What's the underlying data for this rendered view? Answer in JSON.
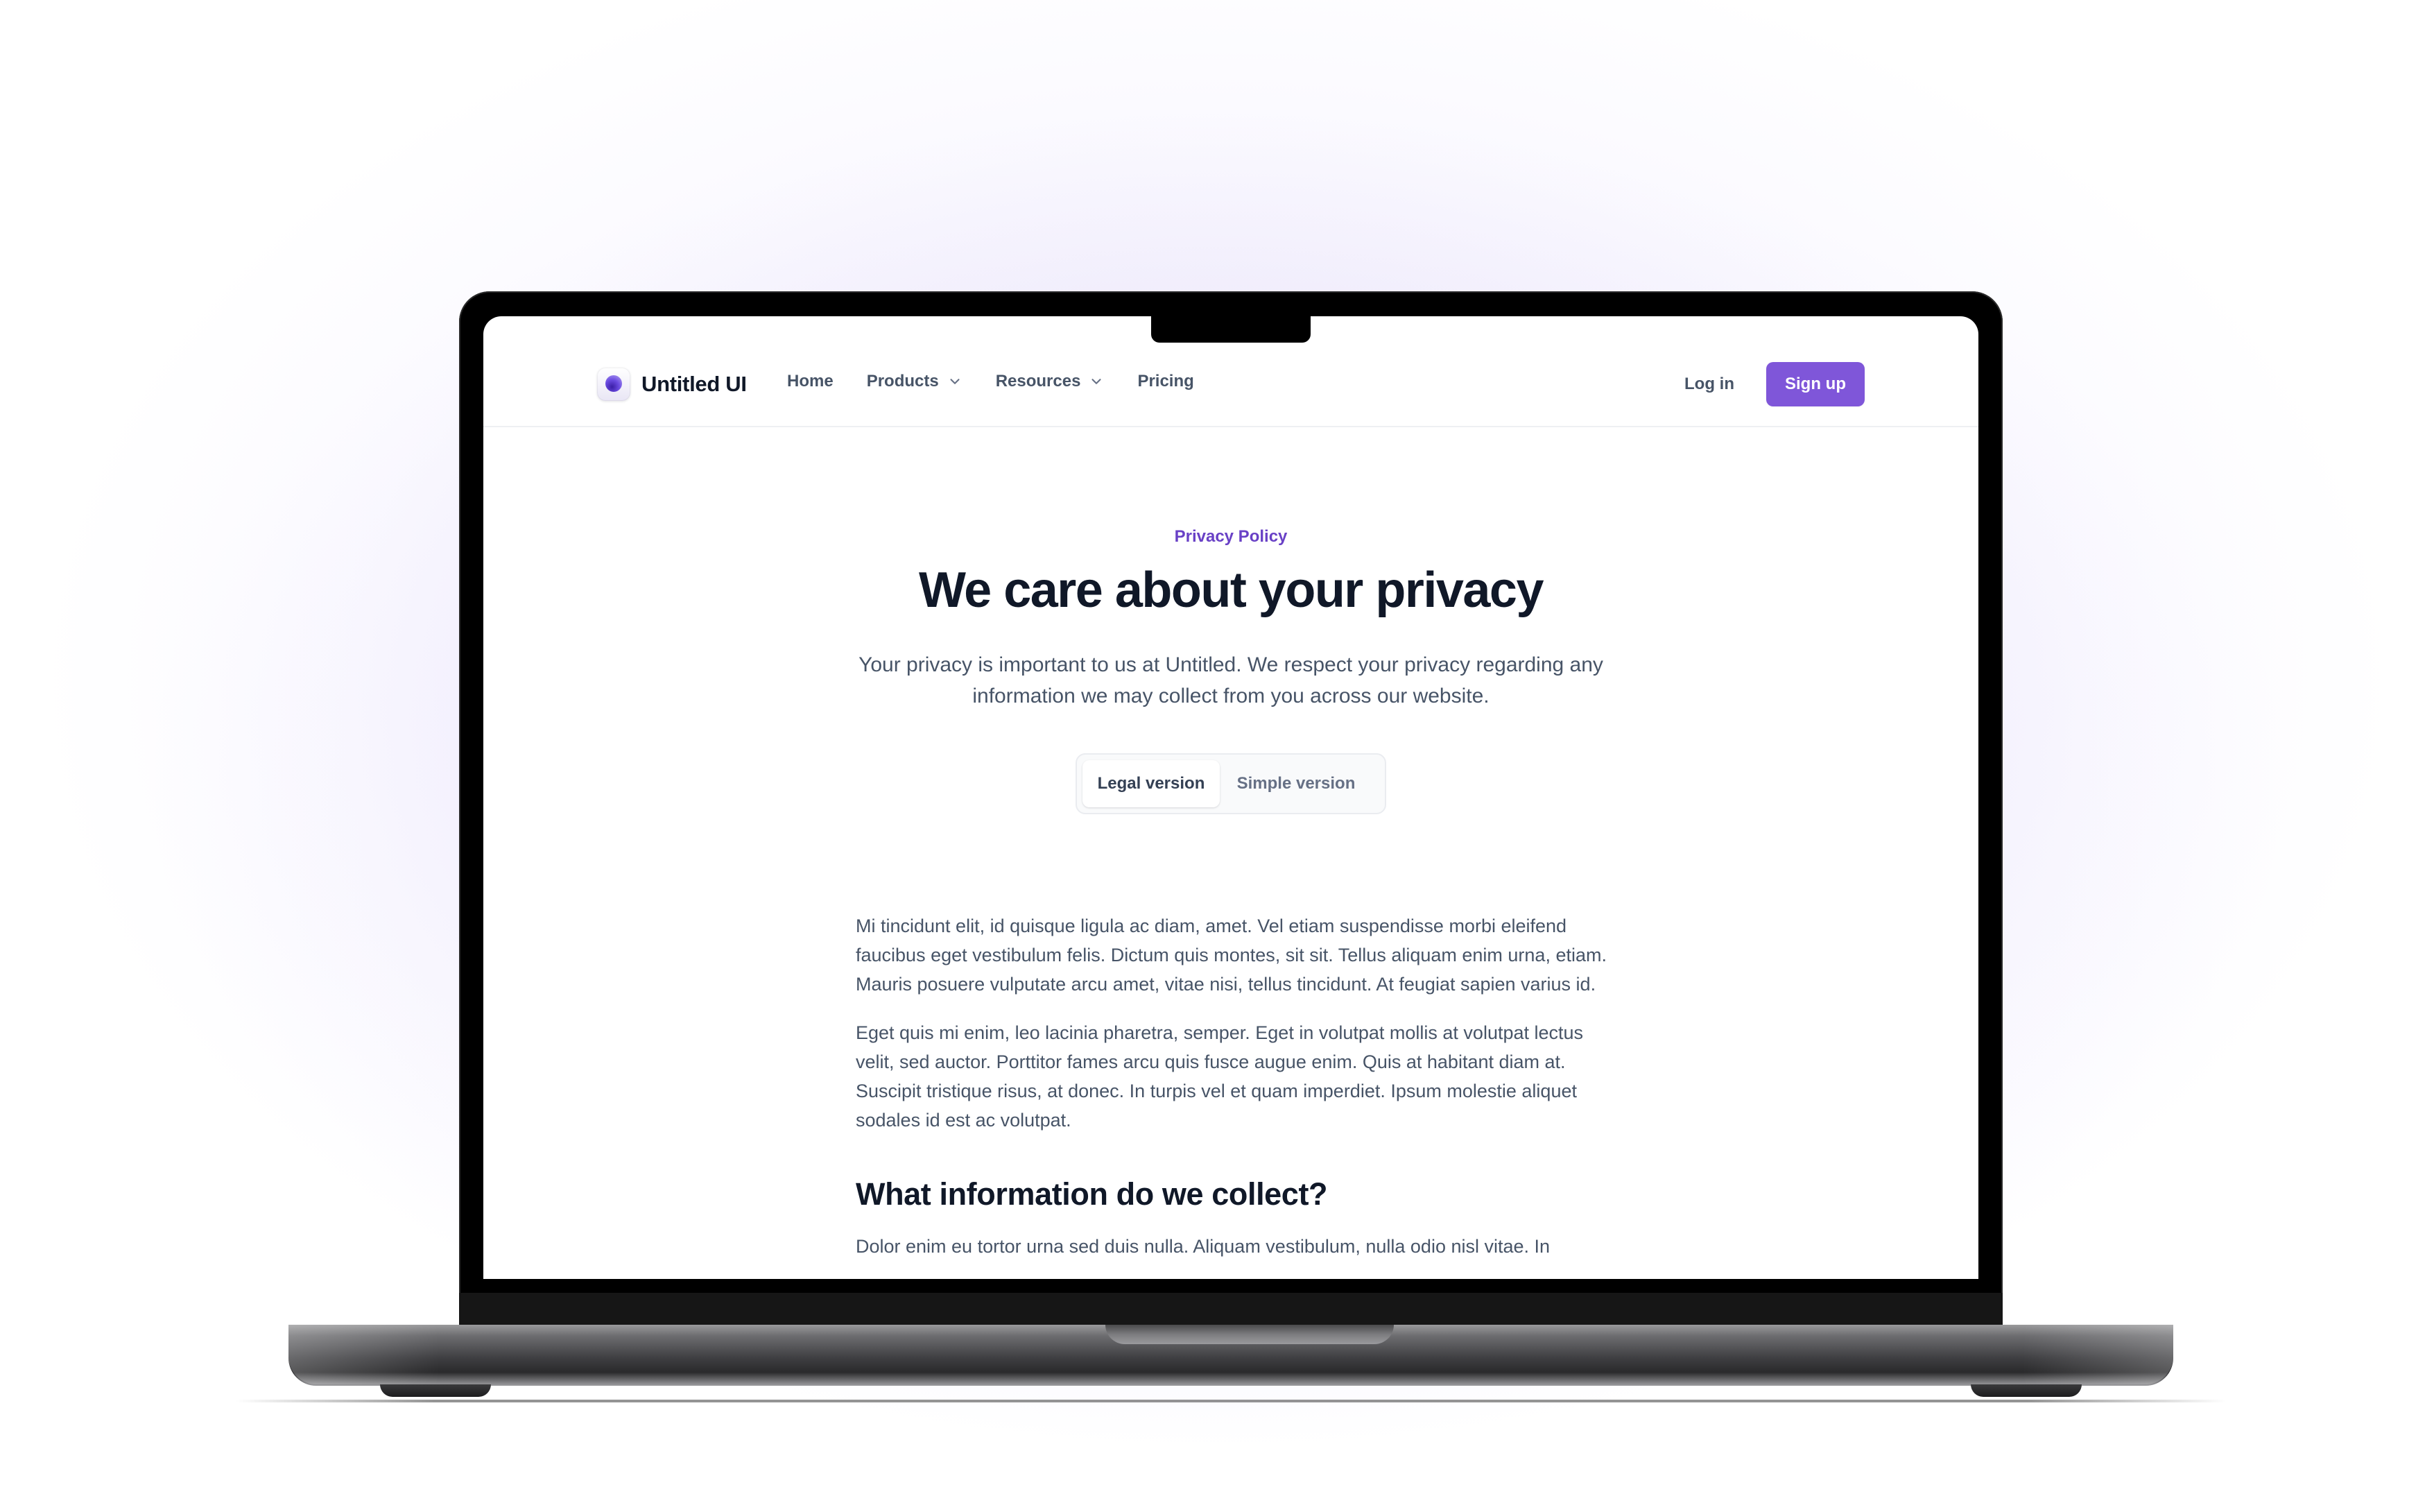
{
  "brand": {
    "name": "Untitled UI",
    "accent_color": "#7f56d9",
    "eyebrow_color": "#6941c6"
  },
  "nav": {
    "links": [
      {
        "label": "Home",
        "has_dropdown": false
      },
      {
        "label": "Products",
        "has_dropdown": true
      },
      {
        "label": "Resources",
        "has_dropdown": true
      },
      {
        "label": "Pricing",
        "has_dropdown": false
      }
    ],
    "login_label": "Log in",
    "signup_label": "Sign up"
  },
  "hero": {
    "eyebrow": "Privacy Policy",
    "title": "We care about your privacy",
    "subtitle": "Your privacy is important to us at Untitled. We respect your privacy regarding any information we may collect from you across our website."
  },
  "version_toggle": {
    "options": [
      "Legal version",
      "Simple version"
    ],
    "selected": "Legal version"
  },
  "content": {
    "paragraphs": [
      "Mi tincidunt elit, id quisque ligula ac diam, amet. Vel etiam suspendisse morbi eleifend faucibus eget vestibulum felis. Dictum quis montes, sit sit. Tellus aliquam enim urna, etiam. Mauris posuere vulputate arcu amet, vitae nisi, tellus tincidunt. At feugiat sapien varius id.",
      "Eget quis mi enim, leo lacinia pharetra, semper. Eget in volutpat mollis at volutpat lectus velit, sed auctor. Porttitor fames arcu quis fusce augue enim. Quis at habitant diam at. Suscipit tristique risus, at donec. In turpis vel et quam imperdiet. Ipsum molestie aliquet sodales id est ac volutpat."
    ],
    "section_heading": "What information do we collect?",
    "section_paragraph_partial": "Dolor enim eu tortor urna sed duis nulla. Aliquam vestibulum, nulla odio nisl vitae. In"
  }
}
